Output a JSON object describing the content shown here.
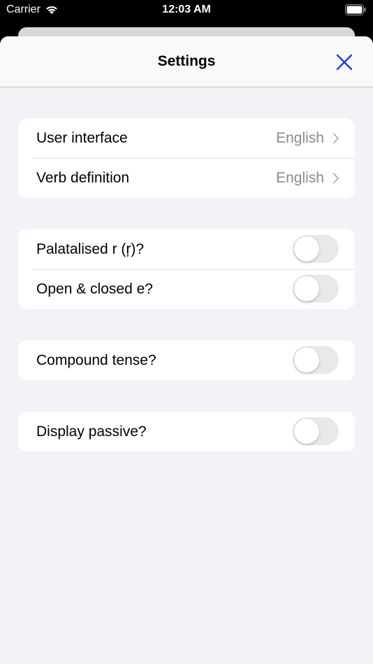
{
  "status_bar": {
    "carrier": "Carrier",
    "time": "12:03 AM",
    "wifi_icon": "wifi-icon",
    "battery_icon": "battery-icon"
  },
  "nav": {
    "title": "Settings",
    "close_icon": "close-icon"
  },
  "accent_color": "#1a3bd8",
  "groups": [
    {
      "rows": [
        {
          "label": "User interface",
          "value": "English",
          "type": "disclosure"
        },
        {
          "label": "Verb definition",
          "value": "English",
          "type": "disclosure"
        }
      ]
    },
    {
      "rows": [
        {
          "label": "Palatalised r (ŗ)?",
          "type": "toggle",
          "on": false
        },
        {
          "label": "Open & closed e?",
          "type": "toggle",
          "on": false
        }
      ]
    },
    {
      "rows": [
        {
          "label": "Compound tense?",
          "type": "toggle",
          "on": false
        }
      ]
    },
    {
      "rows": [
        {
          "label": "Display passive?",
          "type": "toggle",
          "on": false
        }
      ]
    }
  ]
}
